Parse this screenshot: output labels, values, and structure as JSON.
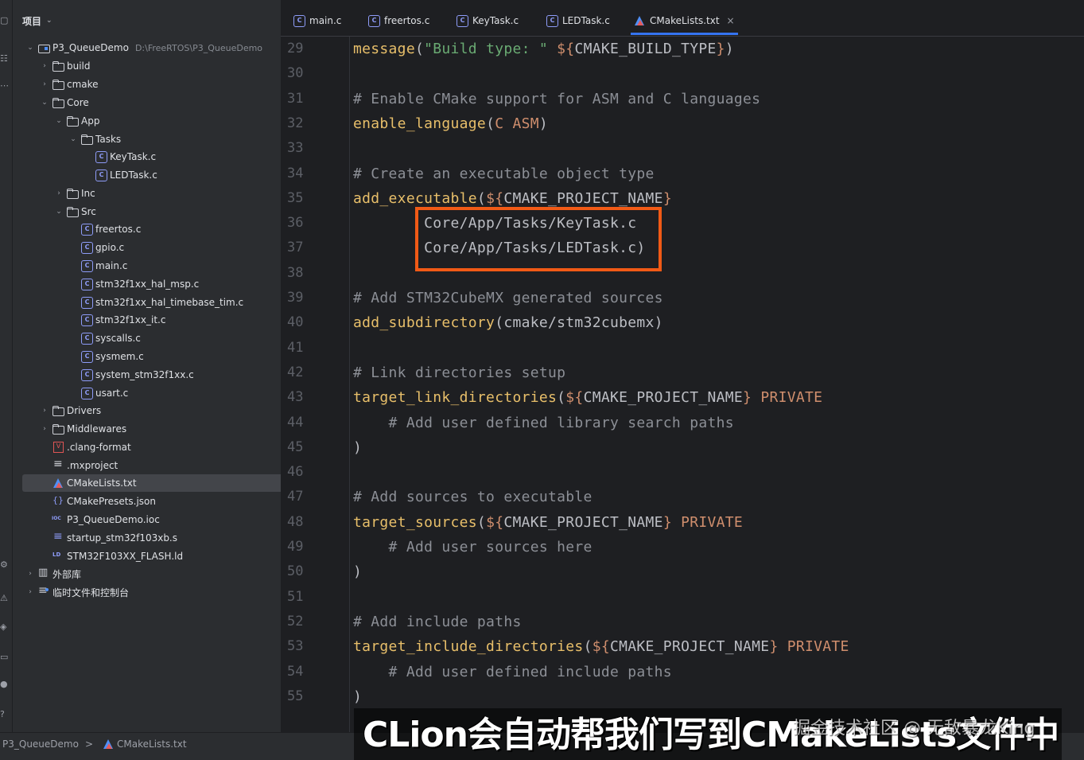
{
  "project_panel": {
    "title": "项目",
    "tree": [
      {
        "label": "P3_QueueDemo",
        "hint": "D:\\FreeRTOS\\P3_QueueDemo",
        "icon": "module-icon",
        "expanded": true
      },
      {
        "label": "build",
        "icon": "folder-icon"
      },
      {
        "label": "cmake",
        "icon": "folder-icon"
      },
      {
        "label": "Core",
        "icon": "folder-icon",
        "expanded": true
      },
      {
        "label": "App",
        "icon": "folder-icon",
        "expanded": true
      },
      {
        "label": "Tasks",
        "icon": "folder-icon",
        "expanded": true
      },
      {
        "label": "KeyTask.c",
        "icon": "c-file-icon"
      },
      {
        "label": "LEDTask.c",
        "icon": "c-file-icon"
      },
      {
        "label": "Inc",
        "icon": "folder-icon"
      },
      {
        "label": "Src",
        "icon": "folder-icon",
        "expanded": true
      },
      {
        "label": "freertos.c",
        "icon": "c-file-icon"
      },
      {
        "label": "gpio.c",
        "icon": "c-file-icon"
      },
      {
        "label": "main.c",
        "icon": "c-file-icon"
      },
      {
        "label": "stm32f1xx_hal_msp.c",
        "icon": "c-file-icon"
      },
      {
        "label": "stm32f1xx_hal_timebase_tim.c",
        "icon": "c-file-icon"
      },
      {
        "label": "stm32f1xx_it.c",
        "icon": "c-file-icon"
      },
      {
        "label": "syscalls.c",
        "icon": "c-file-icon"
      },
      {
        "label": "sysmem.c",
        "icon": "c-file-icon"
      },
      {
        "label": "system_stm32f1xx.c",
        "icon": "c-file-icon"
      },
      {
        "label": "usart.c",
        "icon": "c-file-icon"
      },
      {
        "label": "Drivers",
        "icon": "folder-icon"
      },
      {
        "label": "Middlewares",
        "icon": "folder-icon"
      },
      {
        "label": ".clang-format",
        "icon": "clang-format-icon"
      },
      {
        "label": ".mxproject",
        "icon": "text-file-icon"
      },
      {
        "label": "CMakeLists.txt",
        "icon": "cmake-icon",
        "selected": true
      },
      {
        "label": "CMakePresets.json",
        "icon": "json-icon"
      },
      {
        "label": "P3_QueueDemo.ioc",
        "icon": "ioc-icon"
      },
      {
        "label": "startup_stm32f103xb.s",
        "icon": "asm-file-icon"
      },
      {
        "label": "STM32F103XX_FLASH.ld",
        "icon": "linker-script-icon"
      },
      {
        "label": "外部库",
        "icon": "library-icon"
      },
      {
        "label": "临时文件和控制台",
        "icon": "scratches-icon"
      }
    ]
  },
  "tabs": [
    {
      "label": "main.c",
      "icon": "c-file-icon"
    },
    {
      "label": "freertos.c",
      "icon": "c-file-icon"
    },
    {
      "label": "KeyTask.c",
      "icon": "c-file-icon"
    },
    {
      "label": "LEDTask.c",
      "icon": "c-file-icon"
    },
    {
      "label": "CMakeLists.txt",
      "icon": "cmake-icon",
      "active": true,
      "close": "×"
    }
  ],
  "editor": {
    "lines": [
      {
        "n": "29",
        "tokens": [
          [
            "fn",
            "message"
          ],
          [
            "plain",
            "("
          ],
          [
            "str",
            "\"Build type: \""
          ],
          [
            "plain",
            " "
          ],
          [
            "var",
            "${"
          ],
          [
            "plain",
            "CMAKE_BUILD_TYPE"
          ],
          [
            "var",
            "}"
          ],
          [
            "plain",
            ")"
          ]
        ]
      },
      {
        "n": "30",
        "tokens": []
      },
      {
        "n": "31",
        "tokens": [
          [
            "cmt",
            "# Enable CMake support for ASM and C languages"
          ]
        ]
      },
      {
        "n": "32",
        "tokens": [
          [
            "fn",
            "enable_language"
          ],
          [
            "plain",
            "("
          ],
          [
            "kw",
            "C ASM"
          ],
          [
            "plain",
            ")"
          ]
        ]
      },
      {
        "n": "33",
        "tokens": []
      },
      {
        "n": "34",
        "tokens": [
          [
            "cmt",
            "# Create an executable object type"
          ]
        ]
      },
      {
        "n": "35",
        "tokens": [
          [
            "fn",
            "add_executable"
          ],
          [
            "plain",
            "("
          ],
          [
            "var",
            "${"
          ],
          [
            "plain",
            "CMAKE_PROJECT_NAME"
          ],
          [
            "var",
            "}"
          ]
        ]
      },
      {
        "n": "36",
        "tokens": [
          [
            "plain",
            "        Core/App/Tasks/KeyTask.c"
          ]
        ]
      },
      {
        "n": "37",
        "tokens": [
          [
            "plain",
            "        Core/App/Tasks/LEDTask.c)"
          ]
        ]
      },
      {
        "n": "38",
        "tokens": []
      },
      {
        "n": "39",
        "tokens": [
          [
            "cmt",
            "# Add STM32CubeMX generated sources"
          ]
        ]
      },
      {
        "n": "40",
        "tokens": [
          [
            "fn",
            "add_subdirectory"
          ],
          [
            "plain",
            "(cmake/stm32cubemx)"
          ]
        ]
      },
      {
        "n": "41",
        "tokens": []
      },
      {
        "n": "42",
        "tokens": [
          [
            "cmt",
            "# Link directories setup"
          ]
        ]
      },
      {
        "n": "43",
        "tokens": [
          [
            "fn",
            "target_link_directories"
          ],
          [
            "plain",
            "("
          ],
          [
            "var",
            "${"
          ],
          [
            "plain",
            "CMAKE_PROJECT_NAME"
          ],
          [
            "var",
            "}"
          ],
          [
            "plain",
            " "
          ],
          [
            "kw",
            "PRIVATE"
          ]
        ]
      },
      {
        "n": "44",
        "tokens": [
          [
            "cmt",
            "    # Add user defined library search paths"
          ]
        ]
      },
      {
        "n": "45",
        "tokens": [
          [
            "plain",
            ")"
          ]
        ]
      },
      {
        "n": "46",
        "tokens": []
      },
      {
        "n": "47",
        "tokens": [
          [
            "cmt",
            "# Add sources to executable"
          ]
        ]
      },
      {
        "n": "48",
        "tokens": [
          [
            "fn",
            "target_sources"
          ],
          [
            "plain",
            "("
          ],
          [
            "var",
            "${"
          ],
          [
            "plain",
            "CMAKE_PROJECT_NAME"
          ],
          [
            "var",
            "}"
          ],
          [
            "plain",
            " "
          ],
          [
            "kw",
            "PRIVATE"
          ]
        ]
      },
      {
        "n": "49",
        "tokens": [
          [
            "cmt",
            "    # Add user sources here"
          ]
        ]
      },
      {
        "n": "50",
        "tokens": [
          [
            "plain",
            ")"
          ]
        ]
      },
      {
        "n": "51",
        "tokens": []
      },
      {
        "n": "52",
        "tokens": [
          [
            "cmt",
            "# Add include paths"
          ]
        ]
      },
      {
        "n": "53",
        "tokens": [
          [
            "fn",
            "target_include_directories"
          ],
          [
            "plain",
            "("
          ],
          [
            "var",
            "${"
          ],
          [
            "plain",
            "CMAKE_PROJECT_NAME"
          ],
          [
            "var",
            "}"
          ],
          [
            "plain",
            " "
          ],
          [
            "kw",
            "PRIVATE"
          ]
        ]
      },
      {
        "n": "54",
        "tokens": [
          [
            "cmt",
            "    # Add user defined include paths"
          ]
        ]
      },
      {
        "n": "55",
        "tokens": [
          [
            "plain",
            ")"
          ]
        ]
      }
    ]
  },
  "statusbar": {
    "project": "P3_QueueDemo",
    "separator": ">",
    "file": "CMakeLists.txt"
  },
  "overlay": {
    "caption": "CLion会自动帮我们写到CMakeLists文件中",
    "watermark": "掘金技术社区 @ 无敌暴龙King",
    "highlight_color": "#f15a16"
  },
  "colors": {
    "accent": "#3574f0",
    "function": "#e8bf6a",
    "string": "#6aab73",
    "comment": "#8c8f96",
    "keyword": "#cf8e6d"
  }
}
